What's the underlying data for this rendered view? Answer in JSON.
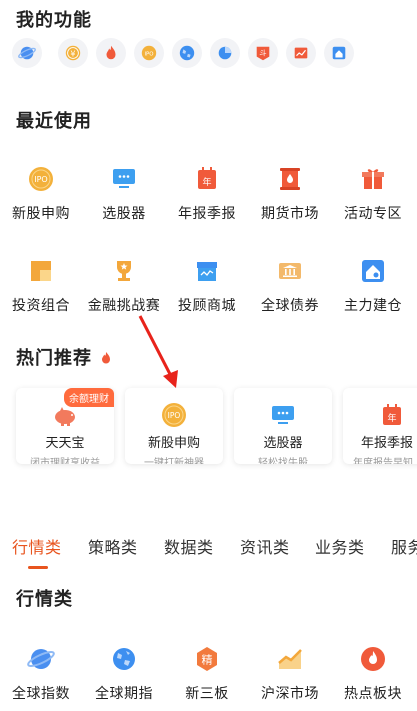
{
  "my_functions": {
    "title": "我的功能",
    "icons": [
      "globe-icon",
      "yuan-coin-icon",
      "flame-icon",
      "ipo-icon",
      "world-icon",
      "pie-chart-icon",
      "dou-icon",
      "chart-card-icon",
      "house-icon"
    ]
  },
  "recent": {
    "title": "最近使用",
    "items": [
      {
        "label": "新股申购",
        "icon": "ipo-icon"
      },
      {
        "label": "选股器",
        "icon": "monitor-icon"
      },
      {
        "label": "年报季报",
        "icon": "calendar-report-icon"
      },
      {
        "label": "期货市场",
        "icon": "drop-scroll-icon"
      },
      {
        "label": "活动专区",
        "icon": "gift-icon"
      },
      {
        "label": "投资组合",
        "icon": "portfolio-icon"
      },
      {
        "label": "金融挑战赛",
        "icon": "trophy-icon"
      },
      {
        "label": "投顾商城",
        "icon": "store-icon"
      },
      {
        "label": "全球债券",
        "icon": "bond-icon"
      },
      {
        "label": "主力建仓",
        "icon": "house-chart-icon"
      }
    ]
  },
  "hot": {
    "title": "热门推荐",
    "cards": [
      {
        "title": "天天宝",
        "sub": "闭市理财享收益",
        "badge": "余额理财",
        "icon": "piggy-icon"
      },
      {
        "title": "新股申购",
        "sub": "一键打新神器",
        "badge": "",
        "icon": "ipo-icon"
      },
      {
        "title": "选股器",
        "sub": "轻松找牛股",
        "badge": "",
        "icon": "monitor-icon"
      },
      {
        "title": "年报季报",
        "sub": "年度报告早知",
        "badge": "",
        "icon": "calendar-report-icon"
      }
    ]
  },
  "tabs": [
    "行情类",
    "策略类",
    "数据类",
    "资讯类",
    "业务类",
    "服务"
  ],
  "active_tab": "行情类",
  "market": {
    "title": "行情类",
    "items": [
      {
        "label": "全球指数",
        "icon": "globe-icon"
      },
      {
        "label": "全球期指",
        "icon": "world-icon"
      },
      {
        "label": "新三板",
        "icon": "jing-icon"
      },
      {
        "label": "沪深市场",
        "icon": "trend-up-icon"
      },
      {
        "label": "热点板块",
        "icon": "flame-icon"
      }
    ]
  },
  "colors": {
    "accent": "#e8541e",
    "orange": "#f0a030",
    "red": "#f05a3a",
    "blue": "#3d8ff0"
  }
}
